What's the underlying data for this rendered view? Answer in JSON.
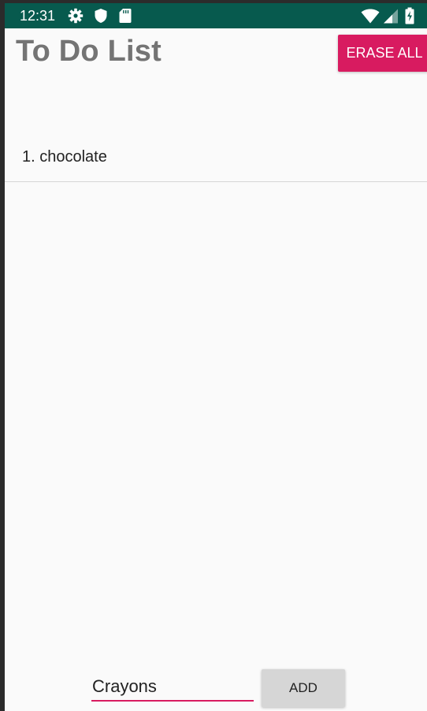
{
  "status_bar": {
    "time": "12:31",
    "left_icons": [
      "gear-icon",
      "shield-icon",
      "sd-card-icon"
    ],
    "right_icons": [
      "wifi-icon",
      "signal-icon",
      "battery-icon"
    ]
  },
  "header": {
    "title": "To Do List",
    "erase_all_label": "ERASE ALL"
  },
  "list": {
    "items": [
      {
        "label": "1. chocolate"
      }
    ]
  },
  "composer": {
    "input_value": "Crayons",
    "add_label": "ADD"
  },
  "colors": {
    "status_bar": "#075a4e",
    "accent": "#d81b60",
    "title": "#747474",
    "background": "#fafafa",
    "add_button": "#d6d6d6"
  }
}
